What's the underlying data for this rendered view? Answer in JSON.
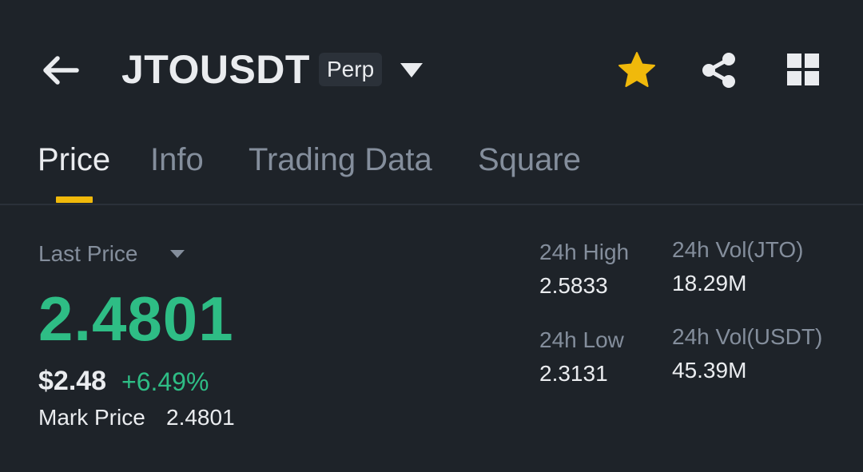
{
  "header": {
    "symbol": "JTOUSDT",
    "badge": "Perp",
    "icons": [
      "back-arrow-icon",
      "chevron-down-icon",
      "star-icon",
      "share-icon",
      "grid-icon"
    ],
    "favorite_color": "#f0b90b"
  },
  "tabs": [
    {
      "label": "Price",
      "active": true
    },
    {
      "label": "Info",
      "active": false
    },
    {
      "label": "Trading Data",
      "active": false
    },
    {
      "label": "Square",
      "active": false
    }
  ],
  "price": {
    "label": "Last Price",
    "last": "2.4801",
    "usd": "$2.48",
    "change": "+6.49%",
    "mark_label": "Mark Price",
    "mark_value": "2.4801"
  },
  "stats": {
    "high_label": "24h High",
    "high_value": "2.5833",
    "low_label": "24h Low",
    "low_value": "2.3131",
    "vol_base_label": "24h Vol(JTO)",
    "vol_base_value": "18.29M",
    "vol_quote_label": "24h Vol(USDT)",
    "vol_quote_value": "45.39M"
  },
  "colors": {
    "background": "#1e2329",
    "up": "#2ebd85",
    "accent": "#f0b90b",
    "muted": "#848e9c",
    "text": "#eaecef"
  }
}
